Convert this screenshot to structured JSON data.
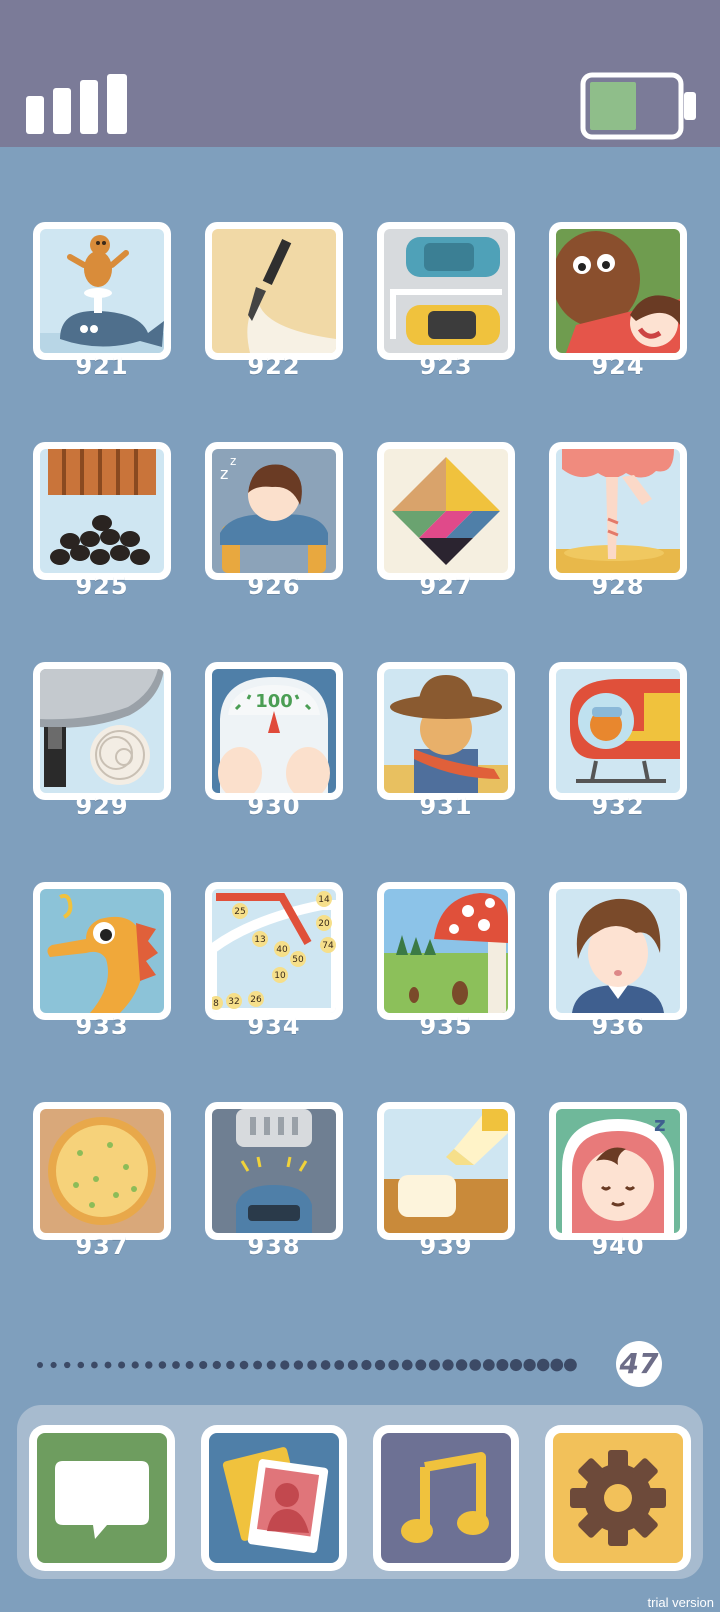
{
  "status": {
    "signal_icon": "signal-bars-icon",
    "battery_icon": "battery-icon",
    "battery_level": 0.55,
    "colors": {
      "bar": "#7b7b98",
      "battery_fill": "#8fbe8a"
    }
  },
  "levels": [
    {
      "number": "921",
      "icon": "seal-on-whale"
    },
    {
      "number": "922",
      "icon": "calligraphy-brush"
    },
    {
      "number": "923",
      "icon": "parked-cars"
    },
    {
      "number": "924",
      "icon": "dog-and-girl"
    },
    {
      "number": "925",
      "icon": "falling-coal"
    },
    {
      "number": "926",
      "icon": "sleeping-student"
    },
    {
      "number": "927",
      "icon": "tangram"
    },
    {
      "number": "928",
      "icon": "ballerina"
    },
    {
      "number": "929",
      "icon": "frying-pan-noodles"
    },
    {
      "number": "930",
      "icon": "bathroom-scale",
      "scale_reading": "100"
    },
    {
      "number": "931",
      "icon": "scarecrow"
    },
    {
      "number": "932",
      "icon": "helicopter-pilot"
    },
    {
      "number": "933",
      "icon": "seahorse"
    },
    {
      "number": "934",
      "icon": "numbered-balls-machine",
      "ball_numbers": [
        "25",
        "14",
        "20",
        "13",
        "40",
        "50",
        "74",
        "10",
        "32",
        "26",
        "8"
      ]
    },
    {
      "number": "935",
      "icon": "giant-mushroom"
    },
    {
      "number": "936",
      "icon": "boy-portrait"
    },
    {
      "number": "937",
      "icon": "pizza"
    },
    {
      "number": "938",
      "icon": "car-under-press"
    },
    {
      "number": "939",
      "icon": "bottle-and-tofu"
    },
    {
      "number": "940",
      "icon": "sleeping-baby"
    }
  ],
  "pager": {
    "page_count": "47",
    "current_page": 47,
    "dots": 40
  },
  "dock": [
    {
      "name": "messages",
      "icon": "speech-bubble-icon",
      "color": "#6e9d5f"
    },
    {
      "name": "photos",
      "icon": "photo-cards-icon",
      "color": "#4f7fa8"
    },
    {
      "name": "music",
      "icon": "music-note-icon",
      "color": "#6d7194"
    },
    {
      "name": "settings",
      "icon": "gear-icon",
      "color": "#f2c15a"
    }
  ],
  "watermark": "trial version"
}
